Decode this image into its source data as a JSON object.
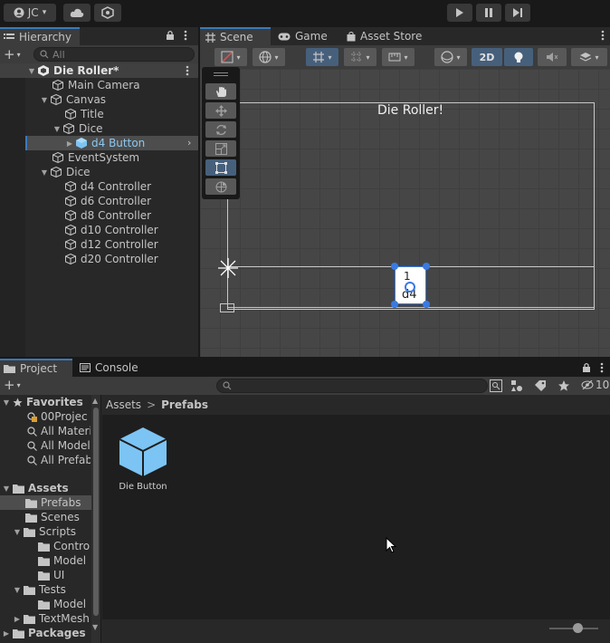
{
  "toolbar": {
    "account_label": "JC",
    "account_caret": "▾",
    "play_icon": "play-icon",
    "pause_icon": "pause-icon",
    "step_icon": "step-icon"
  },
  "hierarchy": {
    "tab_label": "Hierarchy",
    "add_label": "+",
    "add_caret": "▾",
    "search_placeholder": "All",
    "scene_name": "Die Roller*",
    "items": [
      {
        "label": "Main Camera"
      },
      {
        "label": "Canvas"
      },
      {
        "label": "Title"
      },
      {
        "label": "Dice"
      },
      {
        "label": "d4 Button"
      },
      {
        "label": "EventSystem"
      },
      {
        "label": "Dice"
      },
      {
        "label": "d4 Controller"
      },
      {
        "label": "d6 Controller"
      },
      {
        "label": "d8 Controller"
      },
      {
        "label": "d10 Controller"
      },
      {
        "label": "d12 Controller"
      },
      {
        "label": "d20 Controller"
      }
    ]
  },
  "scene_tabs": {
    "scene": "Scene",
    "game": "Game",
    "asset_store": "Asset Store"
  },
  "scene_toolbar": {
    "mode_2d": "2D"
  },
  "scene_view": {
    "canvas_title": "Die Roller!",
    "button_top": "1",
    "button_label": "d4"
  },
  "project": {
    "tab_project": "Project",
    "tab_console": "Console",
    "add_label": "+",
    "add_caret": "▾",
    "hidden_count": "10",
    "breadcrumb": {
      "root": "Assets",
      "sep": ">",
      "current": "Prefabs"
    },
    "favorites_label": "Favorites",
    "favorites": [
      {
        "label": "00Projec"
      },
      {
        "label": "All Materi"
      },
      {
        "label": "All Model"
      },
      {
        "label": "All Prefab"
      }
    ],
    "assets_label": "Assets",
    "folders": [
      {
        "label": "Prefabs"
      },
      {
        "label": "Scenes"
      },
      {
        "label": "Scripts"
      },
      {
        "label": "Contro"
      },
      {
        "label": "Model"
      },
      {
        "label": "UI"
      },
      {
        "label": "Tests"
      },
      {
        "label": "Model"
      },
      {
        "label": "TextMesh"
      }
    ],
    "packages_label": "Packages",
    "asset_items": [
      {
        "label": "Die Button",
        "icon": "prefab-cube-icon"
      }
    ]
  },
  "colors": {
    "accent": "#3a79bb",
    "prefab_blue": "#7cc4f4",
    "selection": "#2c5d87",
    "handle_blue": "#3a7ae0"
  }
}
